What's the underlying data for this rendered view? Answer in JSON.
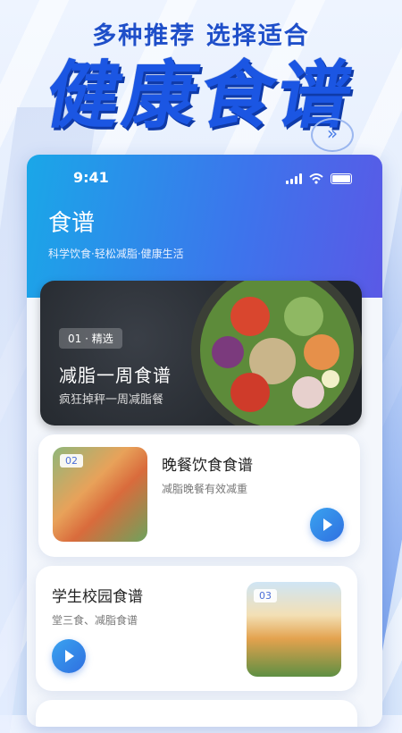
{
  "promo": {
    "tagline": "多种推荐 选择适合",
    "headline": "健康食谱"
  },
  "status_bar": {
    "time": "9:41"
  },
  "app": {
    "title": "食谱",
    "subtitle": "科学饮食·轻松减脂·健康生活"
  },
  "featured": {
    "tag": "01 · 精选",
    "title": "减脂一周食谱",
    "subtitle": "疯狂掉秤一周减脂餐"
  },
  "recipes": [
    {
      "number": "02",
      "title": "晚餐饮食食谱",
      "subtitle": "减脂晚餐有效减重"
    },
    {
      "number": "03",
      "title": "学生校园食谱",
      "subtitle": "堂三食、减脂食谱"
    }
  ],
  "colors": {
    "brand_blue": "#1b56e3",
    "accent": "#2f6fe0"
  },
  "icons": [
    "signal-icon",
    "wifi-icon",
    "battery-icon",
    "play-icon"
  ]
}
